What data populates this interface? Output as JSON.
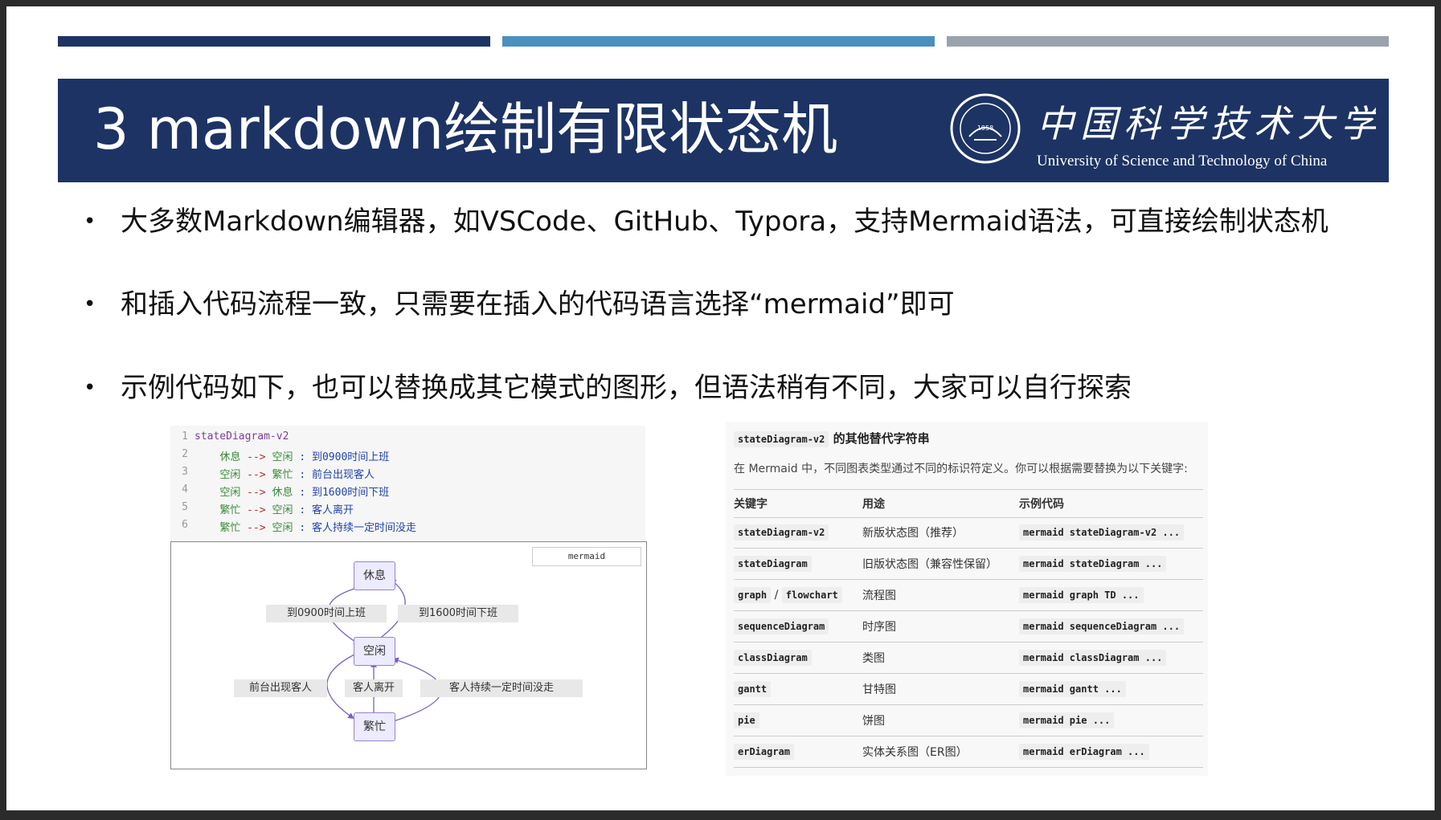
{
  "title": "3 markdown绘制有限状态机",
  "logo": {
    "chinese": "中国科学技术大学",
    "english": "University of Science and Technology of China",
    "seal_year": "1958"
  },
  "colors": {
    "bar1": "#1c3364",
    "bar2": "#4a8fc0",
    "bar3": "#9aa3ad",
    "title_bg": "#1c3364"
  },
  "bullets": [
    "大多数Markdown编辑器，如VSCode、GitHub、Typora，支持Mermaid语法，可直接绘制状态机",
    "和插入代码流程一致，只需要在插入的代码语言选择“mermaid”即可",
    "示例代码如下，也可以替换成其它模式的图形，但语法稍有不同，大家可以自行探索"
  ],
  "code": {
    "lines": [
      {
        "n": "1",
        "header": "stateDiagram-v2"
      },
      {
        "n": "2",
        "from": "休息",
        "arrow": "-->",
        "to": "空闲",
        "sep": ":",
        "label": "到0900时间上班"
      },
      {
        "n": "3",
        "from": "空闲",
        "arrow": "-->",
        "to": "繁忙",
        "sep": ":",
        "label": "前台出现客人"
      },
      {
        "n": "4",
        "from": "空闲",
        "arrow": "-->",
        "to": "休息",
        "sep": ":",
        "label": "到1600时间下班"
      },
      {
        "n": "5",
        "from": "繁忙",
        "arrow": "-->",
        "to": "空闲",
        "sep": ":",
        "label": "客人离开"
      },
      {
        "n": "6",
        "from": "繁忙",
        "arrow": "-->",
        "to": "空闲",
        "sep": ":",
        "label": "客人持续一定时间没走"
      }
    ]
  },
  "diagram": {
    "tag": "mermaid",
    "nodes": {
      "rest": "休息",
      "idle": "空闲",
      "busy": "繁忙"
    },
    "edges": {
      "to_work": "到0900时间上班",
      "off_work": "到1600时间下班",
      "guest_arrives": "前台出现客人",
      "guest_leaves": "客人离开",
      "guest_stays": "客人持续一定时间没走"
    }
  },
  "table": {
    "title_code": "stateDiagram-v2",
    "title_rest": "的其他替代字符串",
    "desc": "在 Mermaid 中，不同图表类型通过不同的标识符定义。你可以根据需要替换为以下关键字:",
    "headers": [
      "关键字",
      "用途",
      "示例代码"
    ],
    "rows": [
      {
        "k": "stateDiagram-v2",
        "k2": "",
        "use": "新版状态图（推荐）",
        "ex": "mermaid stateDiagram-v2 ..."
      },
      {
        "k": "stateDiagram",
        "k2": "",
        "use": "旧版状态图（兼容性保留）",
        "ex": "mermaid stateDiagram ..."
      },
      {
        "k": "graph",
        "k2": "flowchart",
        "sep": "/",
        "use": "流程图",
        "ex": "mermaid graph TD ..."
      },
      {
        "k": "sequenceDiagram",
        "k2": "",
        "use": "时序图",
        "ex": "mermaid sequenceDiagram ..."
      },
      {
        "k": "classDiagram",
        "k2": "",
        "use": "类图",
        "ex": "mermaid classDiagram ..."
      },
      {
        "k": "gantt",
        "k2": "",
        "use": "甘特图",
        "ex": "mermaid gantt ..."
      },
      {
        "k": "pie",
        "k2": "",
        "use": "饼图",
        "ex": "mermaid pie ..."
      },
      {
        "k": "erDiagram",
        "k2": "",
        "use": "实体关系图（ER图）",
        "ex": "mermaid erDiagram ..."
      }
    ]
  }
}
